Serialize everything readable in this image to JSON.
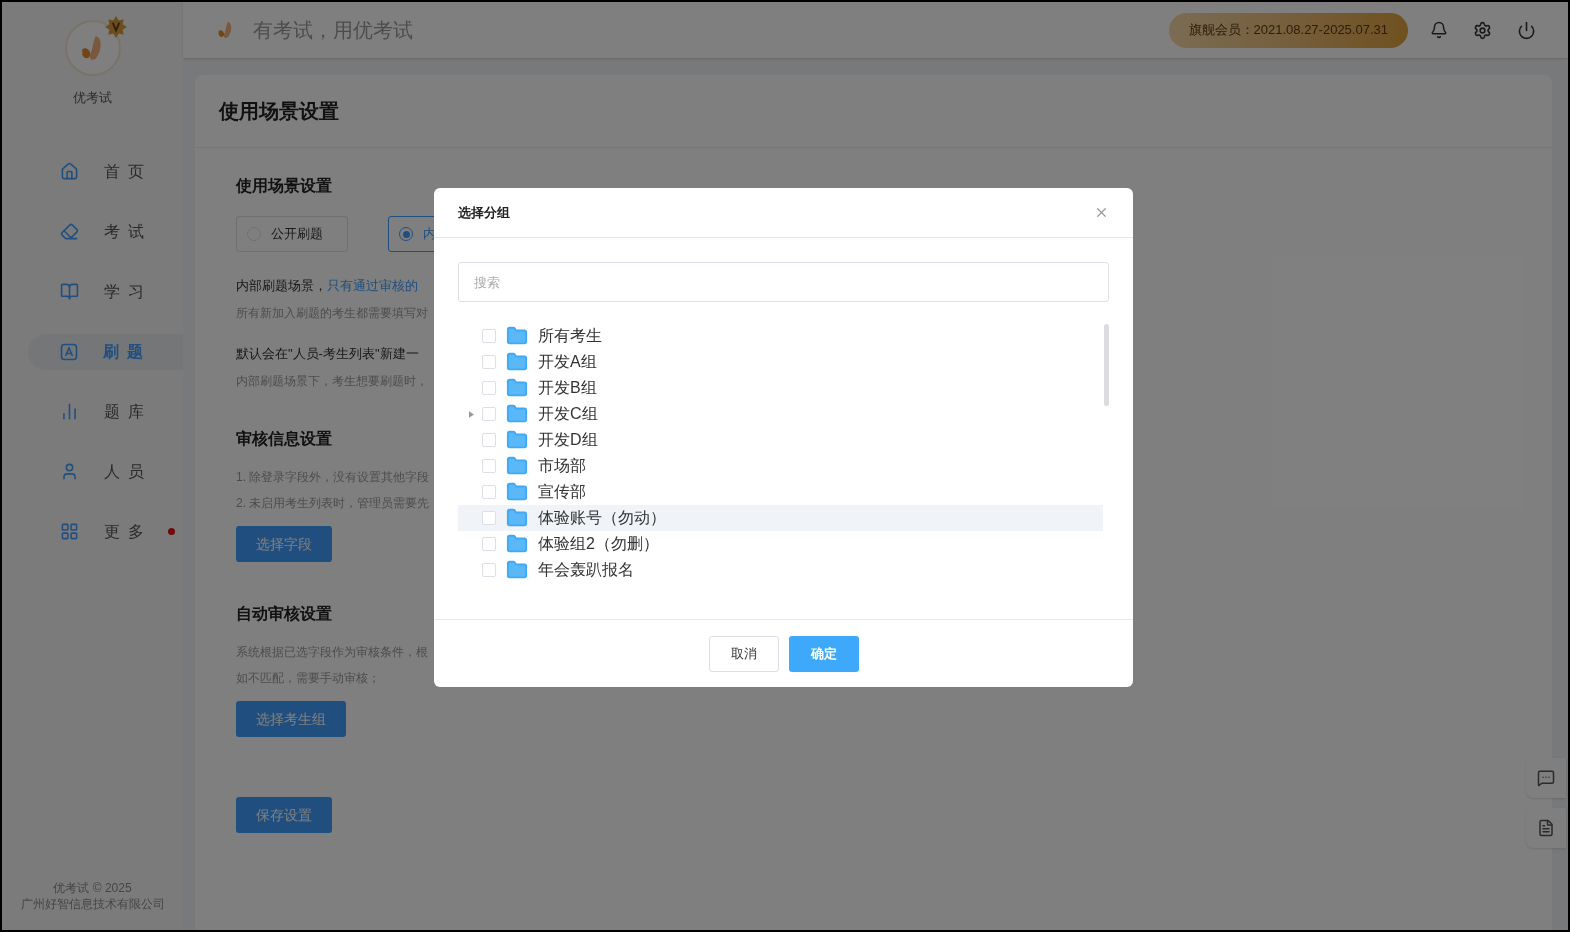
{
  "sidebar": {
    "brand": "优考试",
    "items": [
      {
        "label": "首 页",
        "selected": false,
        "badge": false
      },
      {
        "label": "考 试",
        "selected": false,
        "badge": false
      },
      {
        "label": "学 习",
        "selected": false,
        "badge": false
      },
      {
        "label": "刷 题",
        "selected": true,
        "badge": false
      },
      {
        "label": "题 库",
        "selected": false,
        "badge": false
      },
      {
        "label": "人 员",
        "selected": false,
        "badge": false
      },
      {
        "label": "更 多",
        "selected": false,
        "badge": true
      }
    ],
    "footer": [
      "优考试 © 2025",
      "广州好智信息技术有限公司"
    ]
  },
  "header": {
    "slogan": "有考试，用优考试",
    "membership": "旗舰会员：2021.08.27-2025.07.31"
  },
  "page": {
    "title": "使用场景设置",
    "scene": {
      "heading": "使用场景设置",
      "options": [
        {
          "label": "公开刷题",
          "selected": false
        },
        {
          "label": "内",
          "selected": true
        }
      ],
      "lines": [
        {
          "kind": "strong",
          "text": "内部刷题场景，",
          "link": "只有通过审核的"
        },
        {
          "kind": "hint",
          "text": "所有新加入刷题的考生都需要填写对"
        },
        {
          "kind": "strong",
          "text": "默认会在\"人员-考生列表\"新建一"
        },
        {
          "kind": "hint",
          "text": "内部刷题场景下，考生想要刷题时，"
        }
      ]
    },
    "review": {
      "heading": "审核信息设置",
      "lines": [
        {
          "kind": "hint",
          "text": "1. 除登录字段外，没有设置其他字段"
        },
        {
          "kind": "hint",
          "text": "2. 未启用考生列表时，管理员需要先"
        }
      ],
      "button": "选择字段"
    },
    "auto": {
      "heading": "自动审核设置",
      "lines": [
        {
          "kind": "hint",
          "text": "系统根据已选字段作为审核条件，根"
        },
        {
          "kind": "hint",
          "text": "如不匹配，需要手动审核；"
        }
      ],
      "button": "选择考生组"
    },
    "save_button": "保存设置"
  },
  "dialog": {
    "title": "选择分组",
    "search_placeholder": "搜索",
    "groups": [
      {
        "label": "所有考生",
        "checked": false,
        "expandable": false,
        "highlighted": false
      },
      {
        "label": "开发A组",
        "checked": false,
        "expandable": false,
        "highlighted": false
      },
      {
        "label": "开发B组",
        "checked": false,
        "expandable": false,
        "highlighted": false
      },
      {
        "label": "开发C组",
        "checked": false,
        "expandable": true,
        "highlighted": false
      },
      {
        "label": "开发D组",
        "checked": false,
        "expandable": false,
        "highlighted": false
      },
      {
        "label": "市场部",
        "checked": false,
        "expandable": false,
        "highlighted": false
      },
      {
        "label": "宣传部",
        "checked": false,
        "expandable": false,
        "highlighted": false
      },
      {
        "label": "体验账号（勿动）",
        "checked": false,
        "expandable": false,
        "highlighted": true
      },
      {
        "label": "体验组2（勿删）",
        "checked": false,
        "expandable": false,
        "highlighted": false
      },
      {
        "label": "年会轰趴报名",
        "checked": false,
        "expandable": false,
        "highlighted": false
      }
    ],
    "buttons": [
      {
        "label": "取消",
        "kind": "default"
      },
      {
        "label": "确定",
        "kind": "primary"
      }
    ]
  }
}
